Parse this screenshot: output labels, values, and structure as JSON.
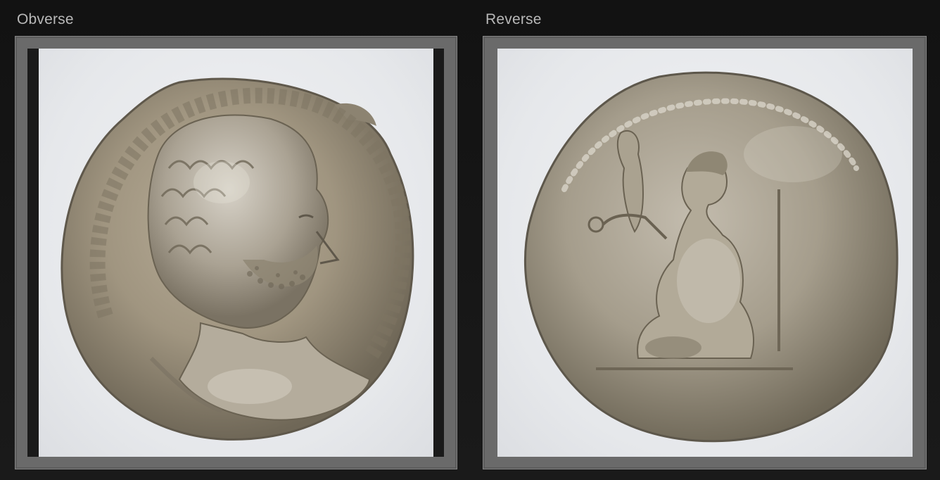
{
  "panels": [
    {
      "label": "Obverse"
    },
    {
      "label": "Reverse"
    }
  ]
}
